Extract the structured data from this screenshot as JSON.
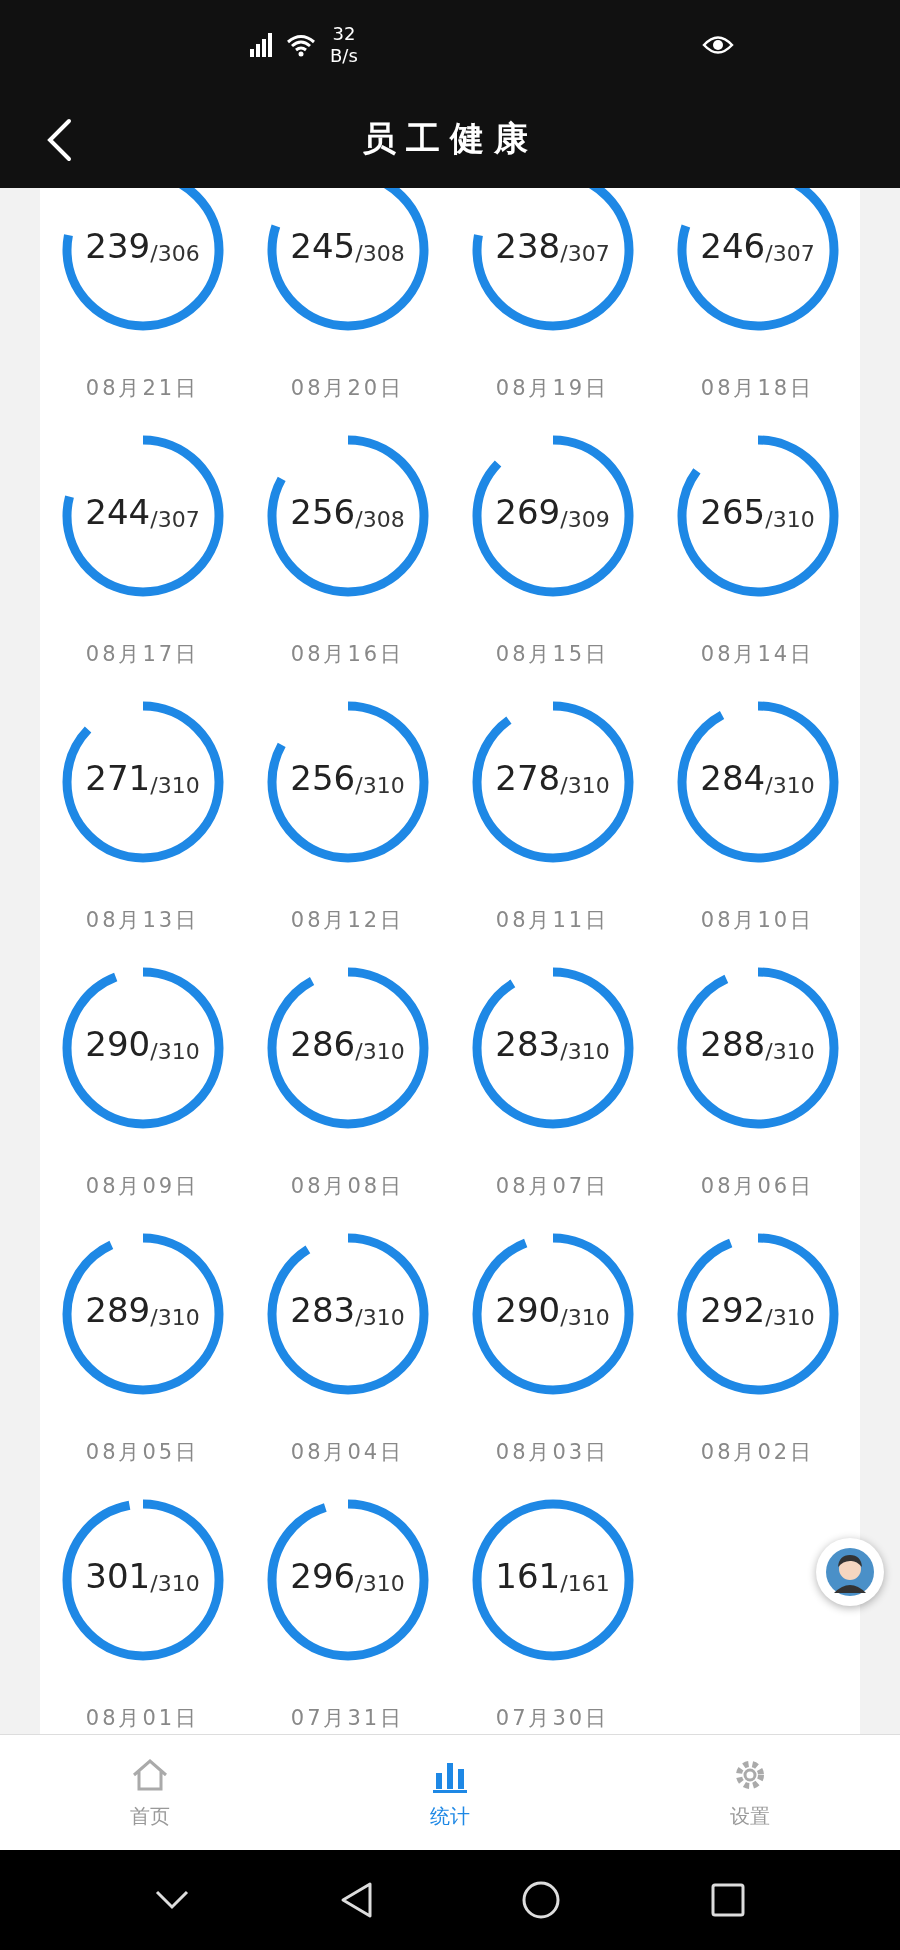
{
  "status_bar": {
    "speed_value": "32",
    "speed_unit": "B/s"
  },
  "header": {
    "title": "员工健康"
  },
  "days": [
    {
      "count": "239",
      "total": "/306",
      "level": 0.78,
      "date": "08月21日"
    },
    {
      "count": "245",
      "total": "/308",
      "level": 0.8,
      "date": "08月20日"
    },
    {
      "count": "238",
      "total": "/307",
      "level": 0.78,
      "date": "08月19日"
    },
    {
      "count": "246",
      "total": "/307",
      "level": 0.8,
      "date": "08月18日"
    },
    {
      "count": "244",
      "total": "/307",
      "level": 0.79,
      "date": "08月17日"
    },
    {
      "count": "256",
      "total": "/308",
      "level": 0.83,
      "date": "08月16日"
    },
    {
      "count": "269",
      "total": "/309",
      "level": 0.87,
      "date": "08月15日"
    },
    {
      "count": "265",
      "total": "/310",
      "level": 0.85,
      "date": "08月14日"
    },
    {
      "count": "271",
      "total": "/310",
      "level": 0.87,
      "date": "08月13日"
    },
    {
      "count": "256",
      "total": "/310",
      "level": 0.83,
      "date": "08月12日"
    },
    {
      "count": "278",
      "total": "/310",
      "level": 0.9,
      "date": "08月11日"
    },
    {
      "count": "284",
      "total": "/310",
      "level": 0.92,
      "date": "08月10日"
    },
    {
      "count": "290",
      "total": "/310",
      "level": 0.94,
      "date": "08月09日"
    },
    {
      "count": "286",
      "total": "/310",
      "level": 0.92,
      "date": "08月08日"
    },
    {
      "count": "283",
      "total": "/310",
      "level": 0.91,
      "date": "08月07日"
    },
    {
      "count": "288",
      "total": "/310",
      "level": 0.93,
      "date": "08月06日"
    },
    {
      "count": "289",
      "total": "/310",
      "level": 0.93,
      "date": "08月05日"
    },
    {
      "count": "283",
      "total": "/310",
      "level": 0.91,
      "date": "08月04日"
    },
    {
      "count": "290",
      "total": "/310",
      "level": 0.94,
      "date": "08月03日"
    },
    {
      "count": "292",
      "total": "/310",
      "level": 0.94,
      "date": "08月02日"
    },
    {
      "count": "301",
      "total": "/310",
      "level": 0.97,
      "date": "08月01日"
    },
    {
      "count": "296",
      "total": "/310",
      "level": 0.95,
      "date": "07月31日"
    },
    {
      "count": "161",
      "total": "/161",
      "level": 1,
      "date": "07月30日"
    }
  ],
  "tab_bar": [
    {
      "kind": "home",
      "label": "首页",
      "selected": false
    },
    {
      "kind": "stats",
      "label": "统计",
      "selected": true
    },
    {
      "kind": "settings",
      "label": "设置",
      "selected": false
    }
  ]
}
